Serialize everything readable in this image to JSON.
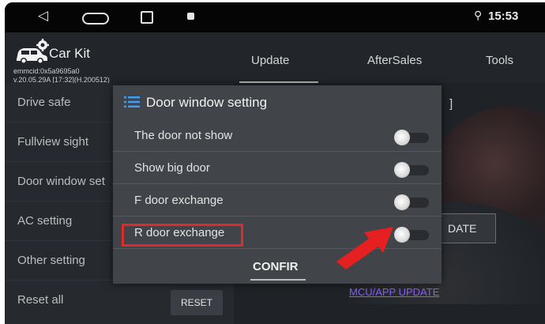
{
  "status_bar": {
    "back_glyph": "◁",
    "pin_glyph": "⚲",
    "time": "15:53"
  },
  "header": {
    "app_title": "Car Kit",
    "device_id": "emmcid:0x5a9695a0",
    "version": "v.20.05.29A [17:32](H.200512)",
    "tabs": [
      "Update",
      "AfterSales",
      "Tools"
    ]
  },
  "sidebar": {
    "items": [
      "Drive safe",
      "Fullview sight",
      "Door window set",
      "AC setting",
      "Other setting",
      "Reset all"
    ],
    "reset_button": "RESET"
  },
  "right_pane": {
    "bracket": "]",
    "update_fragment": "DATE",
    "mcu_link": "MCU/APP UPDATE"
  },
  "dialog": {
    "title": "Door window setting",
    "options": [
      {
        "label": "The door not show",
        "enabled": false
      },
      {
        "label": "Show big door",
        "enabled": false
      },
      {
        "label": "F door exchange",
        "enabled": false
      },
      {
        "label": "R door exchange",
        "enabled": false
      }
    ],
    "confirm_label": "CONFIR",
    "highlight_color": "#e12a2a"
  },
  "colors": {
    "background": "#1b1d21",
    "dialog": "#414448",
    "annotation": "#e12a2a",
    "link": "#8a5cff"
  }
}
